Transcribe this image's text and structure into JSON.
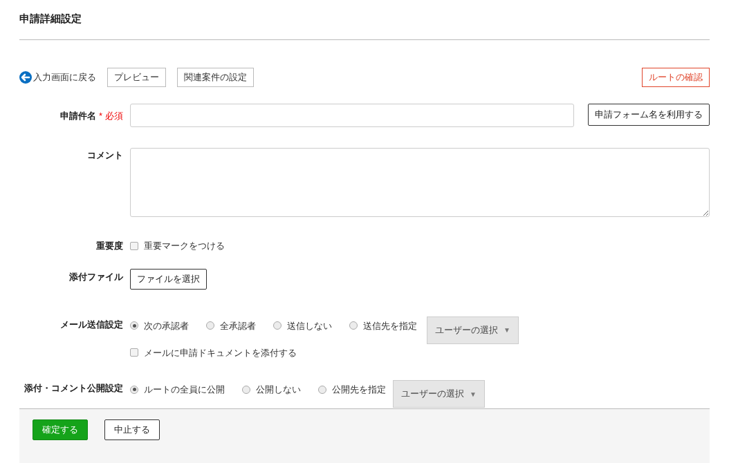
{
  "page_title": "申請詳細設定",
  "toolbar": {
    "back_link": "入力画面に戻る",
    "buttons": [
      "プレビュー",
      "関連案件の設定"
    ],
    "route_button": "ルートの確認"
  },
  "subject": {
    "label": "申請件名",
    "required_mark": "*",
    "required_text": "必須",
    "button": "申請フォーム名を利用する"
  },
  "comment": {
    "label": "コメント"
  },
  "importance": {
    "label": "重要度",
    "checkbox": {
      "label": "重要マークをつける",
      "checked": false
    }
  },
  "attachment": {
    "label": "添付ファイル",
    "button": "ファイルを選択"
  },
  "mail": {
    "label": "メール送信設定",
    "options": [
      {
        "label": "次の承認者",
        "selected": true
      },
      {
        "label": "全承認者",
        "selected": false
      },
      {
        "label": "送信しない",
        "selected": false
      },
      {
        "label": "送信先を指定",
        "selected": false
      }
    ],
    "user_select": {
      "label": "ユーザーの選択",
      "caret": "▼"
    },
    "checkbox": {
      "label": "メールに申請ドキュメントを添付する",
      "checked": false
    }
  },
  "visibility": {
    "label": "添付・コメント公開設定",
    "options": [
      {
        "label": "ルートの全員に公開",
        "selected": true
      },
      {
        "label": "公開しない",
        "selected": false
      },
      {
        "label": "公開先を指定",
        "selected": false
      }
    ],
    "user_select": {
      "label": "ユーザーの選択",
      "caret": "▼"
    }
  },
  "footer": {
    "confirm": "確定する",
    "cancel": "中止する"
  }
}
